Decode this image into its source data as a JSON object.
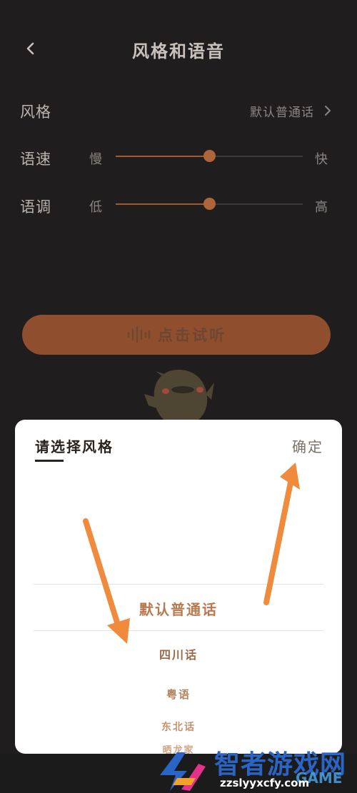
{
  "header": {
    "title": "风格和语音"
  },
  "settings": {
    "style": {
      "label": "风格",
      "value": "默认普通话"
    },
    "speed": {
      "label": "语速",
      "min_label": "慢",
      "max_label": "快",
      "level_percent": 50
    },
    "pitch": {
      "label": "语调",
      "min_label": "低",
      "max_label": "高",
      "level_percent": 50
    }
  },
  "listen_button": {
    "label": "点击试听"
  },
  "sheet": {
    "title": "请选择风格",
    "confirm_label": "确定",
    "options": [
      "默认普通话",
      "四川话",
      "粤语",
      "东北话",
      "晒龙家"
    ],
    "selected": "默认普通话"
  },
  "watermark": {
    "title": "智者游戏网",
    "url": "zzslyyxcfy.com",
    "tag": "GAME"
  },
  "colors": {
    "accent": "#8f4f2e",
    "background": "#1f1d1e",
    "sheet": "#ffffff",
    "annotation_arrow": "#f08a3c"
  },
  "icons": {
    "back": "chevron-left-icon",
    "chevron": "chevron-right-icon",
    "sound": "sound-wave-icon"
  }
}
